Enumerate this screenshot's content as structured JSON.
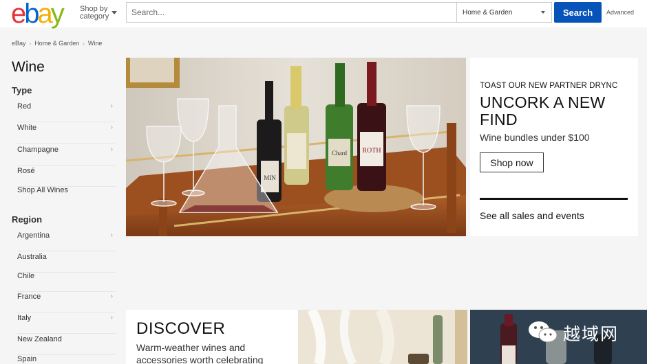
{
  "header": {
    "logo_letters": [
      "e",
      "b",
      "a",
      "y"
    ],
    "logo_colors": [
      "#e53238",
      "#0064d2",
      "#f5af02",
      "#86b817"
    ],
    "shop_by_category": "Shop by category",
    "search_placeholder": "Search...",
    "category_selected": "Home & Garden",
    "search_button": "Search",
    "advanced_link": "Advanced",
    "accent_color": "#0654ba"
  },
  "breadcrumb": [
    "eBay",
    "Home & Garden",
    "Wine"
  ],
  "sidebar": {
    "title": "Wine",
    "type_heading": "Type",
    "type_items": [
      {
        "label": "Red",
        "chevron": true
      },
      {
        "label": "White",
        "chevron": true
      },
      {
        "label": "Champagne",
        "chevron": true
      },
      {
        "label": "Rosé",
        "chevron": false
      },
      {
        "label": "Shop All Wines",
        "chevron": false
      }
    ],
    "region_heading": "Region",
    "region_items": [
      {
        "label": "Argentina",
        "chevron": true
      },
      {
        "label": "Australia",
        "chevron": false
      },
      {
        "label": "Chile",
        "chevron": false
      },
      {
        "label": "France",
        "chevron": true
      },
      {
        "label": "Italy",
        "chevron": true
      },
      {
        "label": "New Zealand",
        "chevron": false
      },
      {
        "label": "Spain",
        "chevron": false
      }
    ],
    "chevron_glyph": "›"
  },
  "hero": {
    "image_icon": "wine-bar-cart-photo",
    "bottle_labels": [
      "MIN",
      "Chard",
      "ROTH"
    ],
    "promo_kicker": "TOAST OUR NEW PARTNER DRYNC",
    "promo_headline": "UNCORK A NEW FIND",
    "promo_sub": "Wine bundles under $100",
    "promo_button": "Shop now",
    "promo_link": "See all sales and events"
  },
  "discover": {
    "title": "DISCOVER",
    "subtitle": "Warm-weather wines and accessories worth celebrating"
  },
  "watermark": {
    "icon": "wechat-icon",
    "text": "越域网"
  }
}
